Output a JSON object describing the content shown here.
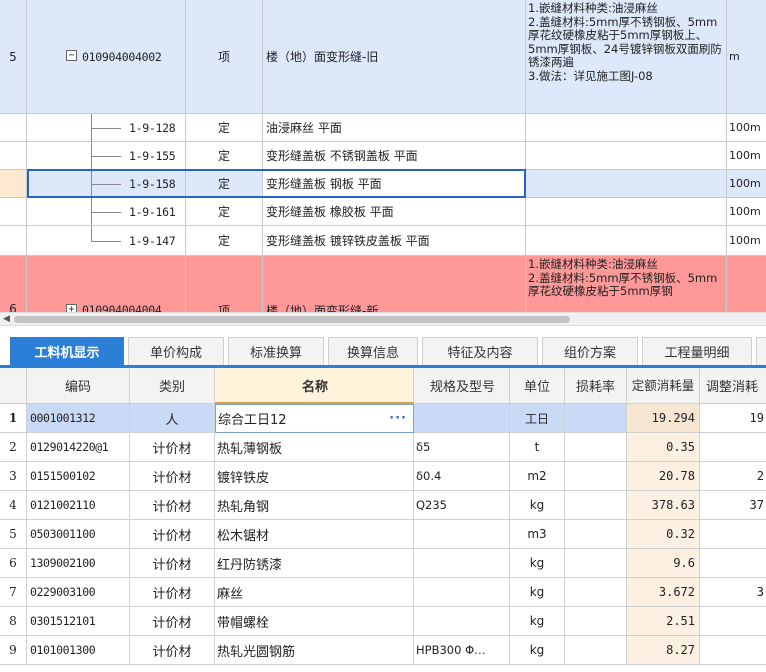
{
  "quota_rows": [
    {
      "index": "5",
      "code": "010904004002",
      "type": "项",
      "name": "楼（地）面变形缝-旧",
      "feature_lines": [
        "1.嵌缝材料种类:油浸麻丝",
        "2.盖缝材料:5mm厚不锈钢板、5mm厚花纹硬橡皮粘于5mm厚钢板上、5mm厚钢板、24号镀锌钢板双面刷防锈漆两遍",
        "3.做法：详见施工图J-08"
      ],
      "unit": "m"
    },
    {
      "index": "",
      "code": "1-9-128",
      "type": "定",
      "name": "油浸麻丝 平面",
      "unit": "100m"
    },
    {
      "index": "",
      "code": "1-9-155",
      "type": "定",
      "name": "变形缝盖板 不锈钢盖板 平面",
      "unit": "100m"
    },
    {
      "index": "",
      "code": "1-9-158",
      "type": "定",
      "name": "变形缝盖板 钢板 平面",
      "unit": "100m"
    },
    {
      "index": "",
      "code": "1-9-161",
      "type": "定",
      "name": "变形缝盖板 橡胶板 平面",
      "unit": "100m"
    },
    {
      "index": "",
      "code": "1-9-147",
      "type": "定",
      "name": "变形缝盖板 镀锌铁皮盖板 平面",
      "unit": "100m"
    },
    {
      "index": "6",
      "code": "010904004004",
      "type": "项",
      "name": "楼（地）面变形缝-新",
      "feature_lines": [
        "1.嵌缝材料种类:油浸麻丝",
        "2.盖缝材料:5mm厚不锈钢板、5mm厚花纹硬橡皮粘于5mm厚钢"
      ],
      "unit": ""
    }
  ],
  "expander_minus": "−",
  "expander_plus": "+",
  "scroll_left_arrow": "◀",
  "tabs": [
    "工料机显示",
    "单价构成",
    "标准换算",
    "换算信息",
    "特征及内容",
    "组价方案",
    "工程量明细",
    "反"
  ],
  "grid_headers": [
    "",
    "编码",
    "类别",
    "名称",
    "规格及型号",
    "单位",
    "损耗率",
    "定额消耗量",
    "调整消耗"
  ],
  "grid_rows": [
    {
      "n": "1",
      "code": "0001001312",
      "cat": "人",
      "name": "综合工日12",
      "spec": "",
      "unit": "工日",
      "loss": "",
      "qty": "19.294",
      "adj": "19"
    },
    {
      "n": "2",
      "code": "0129014220@1",
      "cat": "计价材",
      "name": "热轧薄钢板",
      "spec": "δ5",
      "unit": "t",
      "loss": "",
      "qty": "0.35",
      "adj": ""
    },
    {
      "n": "3",
      "code": "0151500102",
      "cat": "计价材",
      "name": "镀锌铁皮",
      "spec": "δ0.4",
      "unit": "m2",
      "loss": "",
      "qty": "20.78",
      "adj": "2"
    },
    {
      "n": "4",
      "code": "0121002110",
      "cat": "计价材",
      "name": "热轧角钢",
      "spec": "Q235",
      "unit": "kg",
      "loss": "",
      "qty": "378.63",
      "adj": "37"
    },
    {
      "n": "5",
      "code": "0503001100",
      "cat": "计价材",
      "name": "松木锯材",
      "spec": "",
      "unit": "m3",
      "loss": "",
      "qty": "0.32",
      "adj": ""
    },
    {
      "n": "6",
      "code": "1309002100",
      "cat": "计价材",
      "name": "红丹防锈漆",
      "spec": "",
      "unit": "kg",
      "loss": "",
      "qty": "9.6",
      "adj": ""
    },
    {
      "n": "7",
      "code": "0229003100",
      "cat": "计价材",
      "name": "麻丝",
      "spec": "",
      "unit": "kg",
      "loss": "",
      "qty": "3.672",
      "adj": "3"
    },
    {
      "n": "8",
      "code": "0301512101",
      "cat": "计价材",
      "name": "带帽螺栓",
      "spec": "",
      "unit": "kg",
      "loss": "",
      "qty": "2.51",
      "adj": ""
    },
    {
      "n": "9",
      "code": "0101001300",
      "cat": "计价材",
      "name": "热轧光圆钢筋",
      "spec": "HPB300 Φ…",
      "unit": "kg",
      "loss": "",
      "qty": "8.27",
      "adj": ""
    }
  ],
  "ellipsis_button": "···"
}
